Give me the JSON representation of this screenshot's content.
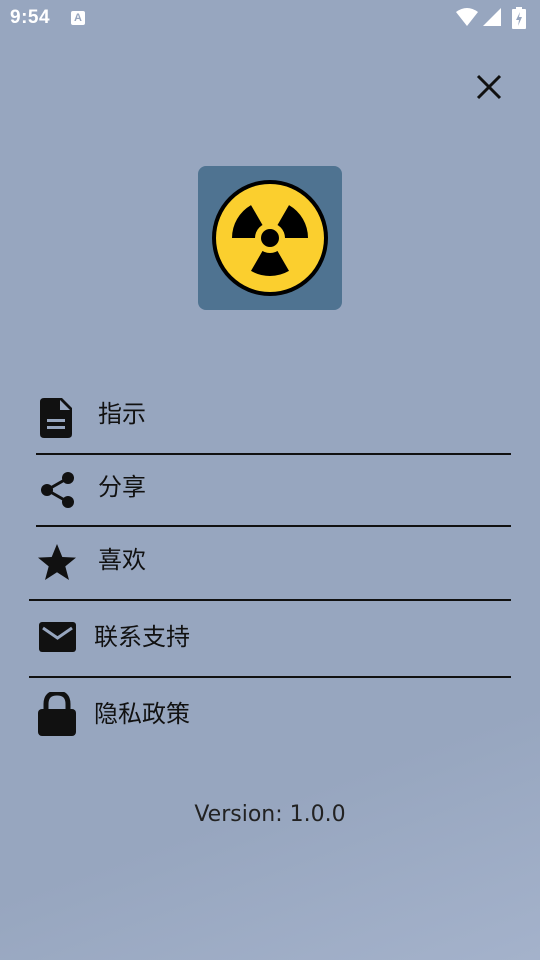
{
  "status_bar": {
    "time": "9:54",
    "notification_badge": "A"
  },
  "menu": {
    "items": [
      {
        "label": "指示",
        "icon": "document-icon"
      },
      {
        "label": "分享",
        "icon": "share-icon"
      },
      {
        "label": "喜欢",
        "icon": "star-icon"
      },
      {
        "label": "联系支持",
        "icon": "mail-icon"
      },
      {
        "label": "隐私政策",
        "icon": "lock-icon"
      }
    ]
  },
  "footer": {
    "version": "Version: 1.0.0"
  },
  "colors": {
    "background": "#97a6bf",
    "logo_tile": "#4f7391",
    "radiation_yellow": "#fbcf2e"
  }
}
